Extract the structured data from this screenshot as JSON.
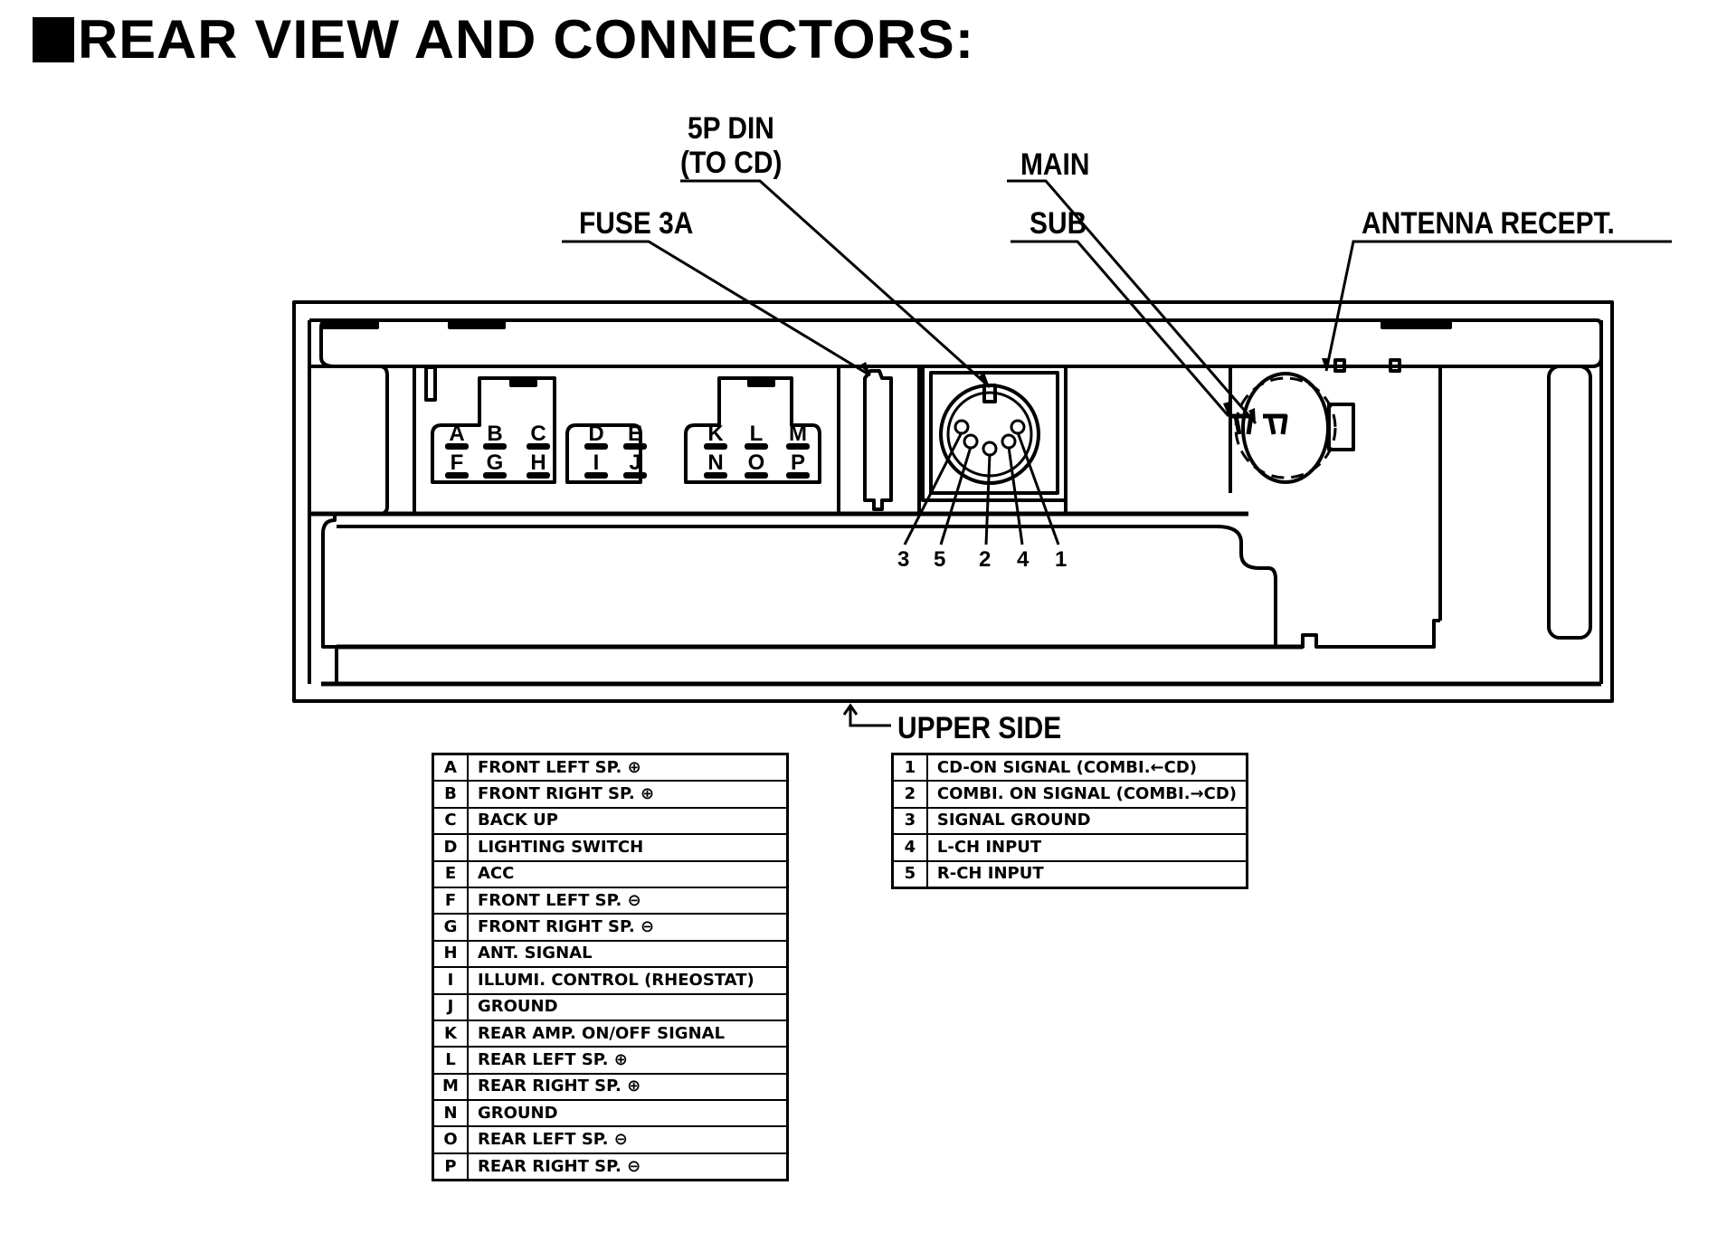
{
  "title": "REAR VIEW AND CONNECTORS:",
  "callouts": {
    "din": "5P DIN",
    "din_sub": "(TO CD)",
    "fuse": "FUSE 3A",
    "main": "MAIN",
    "sub": "SUB",
    "antenna": "ANTENNA RECEPT.",
    "upper_side": "UPPER SIDE"
  },
  "connector_pins": {
    "group1_top": [
      "A",
      "B",
      "C"
    ],
    "group1_bottom": [
      "F",
      "G",
      "H"
    ],
    "group2_top": [
      "D",
      "E"
    ],
    "group2_bottom": [
      "I",
      "J"
    ],
    "group3_top": [
      "K",
      "L",
      "M"
    ],
    "group3_bottom": [
      "N",
      "O",
      "P"
    ]
  },
  "din_pin_numbers": [
    "3",
    "5",
    "2",
    "4",
    "1"
  ],
  "main_connector_table": [
    {
      "pin": "A",
      "function": "FRONT LEFT SP. ⊕"
    },
    {
      "pin": "B",
      "function": "FRONT RIGHT SP. ⊕"
    },
    {
      "pin": "C",
      "function": "BACK UP"
    },
    {
      "pin": "D",
      "function": "LIGHTING SWITCH"
    },
    {
      "pin": "E",
      "function": "ACC"
    },
    {
      "pin": "F",
      "function": "FRONT LEFT SP. ⊖"
    },
    {
      "pin": "G",
      "function": "FRONT RIGHT SP. ⊖"
    },
    {
      "pin": "H",
      "function": "ANT. SIGNAL"
    },
    {
      "pin": "I",
      "function": "ILLUMI. CONTROL (RHEOSTAT)"
    },
    {
      "pin": "J",
      "function": "GROUND"
    },
    {
      "pin": "K",
      "function": "REAR AMP. ON/OFF SIGNAL"
    },
    {
      "pin": "L",
      "function": "REAR LEFT SP. ⊕"
    },
    {
      "pin": "M",
      "function": "REAR RIGHT SP. ⊕"
    },
    {
      "pin": "N",
      "function": "GROUND"
    },
    {
      "pin": "O",
      "function": "REAR LEFT SP. ⊖"
    },
    {
      "pin": "P",
      "function": "REAR RIGHT SP. ⊖"
    }
  ],
  "din_table": [
    {
      "pin": "1",
      "function": "CD-ON SIGNAL (COMBI.←CD)"
    },
    {
      "pin": "2",
      "function": "COMBI. ON SIGNAL (COMBI.→CD)"
    },
    {
      "pin": "3",
      "function": "SIGNAL GROUND"
    },
    {
      "pin": "4",
      "function": "L-CH INPUT"
    },
    {
      "pin": "5",
      "function": "R-CH INPUT"
    }
  ]
}
